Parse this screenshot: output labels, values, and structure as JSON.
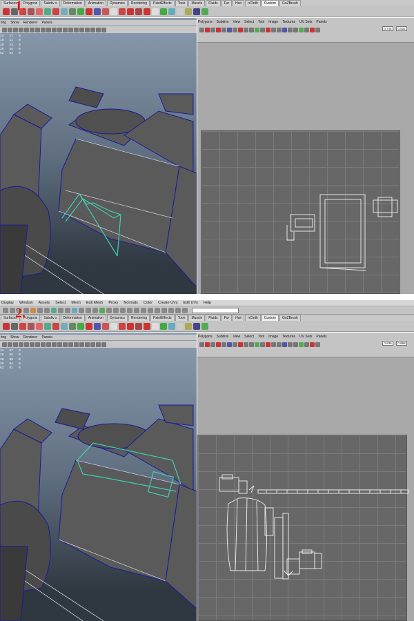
{
  "step1": {
    "number": "1.",
    "shelf_tabs": [
      "Surfaces",
      "Polygons",
      "Subdiv s",
      "Deformation",
      "Animation",
      "Dynamics",
      "Rendering",
      "PaintEffects",
      "Toon",
      "Muscle",
      "Fluids",
      "Fur",
      "Hair",
      "nCloth",
      "Custom",
      "GoZBrush"
    ],
    "active_tab": "Custom",
    "viewport_menu": [
      "ting",
      "Show",
      "Renderer",
      "Panels"
    ],
    "stats": [
      "14   17   0",
      "18   11   0",
      "20   24   0",
      "26   46   0",
      "62   53   0"
    ],
    "uv_menu": [
      "Polygons",
      "Subdivs",
      "View",
      "Select",
      "Tool",
      "Image",
      "Textures",
      "UV Sets",
      "Panels"
    ],
    "uv_u": "0.744",
    "uv_v": "0.922"
  },
  "step2": {
    "number": "2.",
    "main_menu": [
      "Display",
      "Window",
      "Assets",
      "Select",
      "Mesh",
      "Edit Mesh",
      "Proxy",
      "Normals",
      "Color",
      "Create UVs",
      "Edit UVs",
      "Help"
    ],
    "shelf_tabs": [
      "Surfaces",
      "Polygons",
      "Subdiv s",
      "Deformation",
      "Animation",
      "Dynamics",
      "Rendering",
      "PaintEffects",
      "Toon",
      "Muscle",
      "Fluids",
      "Fur",
      "Hair",
      "nCloth",
      "Custom",
      "GoZBrush"
    ],
    "active_tab": "Custom",
    "viewport_menu": [
      "ting",
      "Show",
      "Renderer",
      "Panels"
    ],
    "stats": [
      "14   97   0",
      "18   85   0",
      "20   89   0",
      "26   84   0",
      "62   91   0"
    ],
    "uv_menu": [
      "Polygons",
      "Subdivs",
      "View",
      "Select",
      "Tool",
      "Image",
      "Textures",
      "UV Sets",
      "Panels"
    ],
    "uv_u": "0.936",
    "uv_v": "0.868"
  },
  "colors": {
    "selection": "#3fd0b0",
    "wireframe": "#1a1a9a",
    "mesh": "#5a5a5a",
    "uv_grid": "#676767",
    "step_number": "#dd1111"
  }
}
